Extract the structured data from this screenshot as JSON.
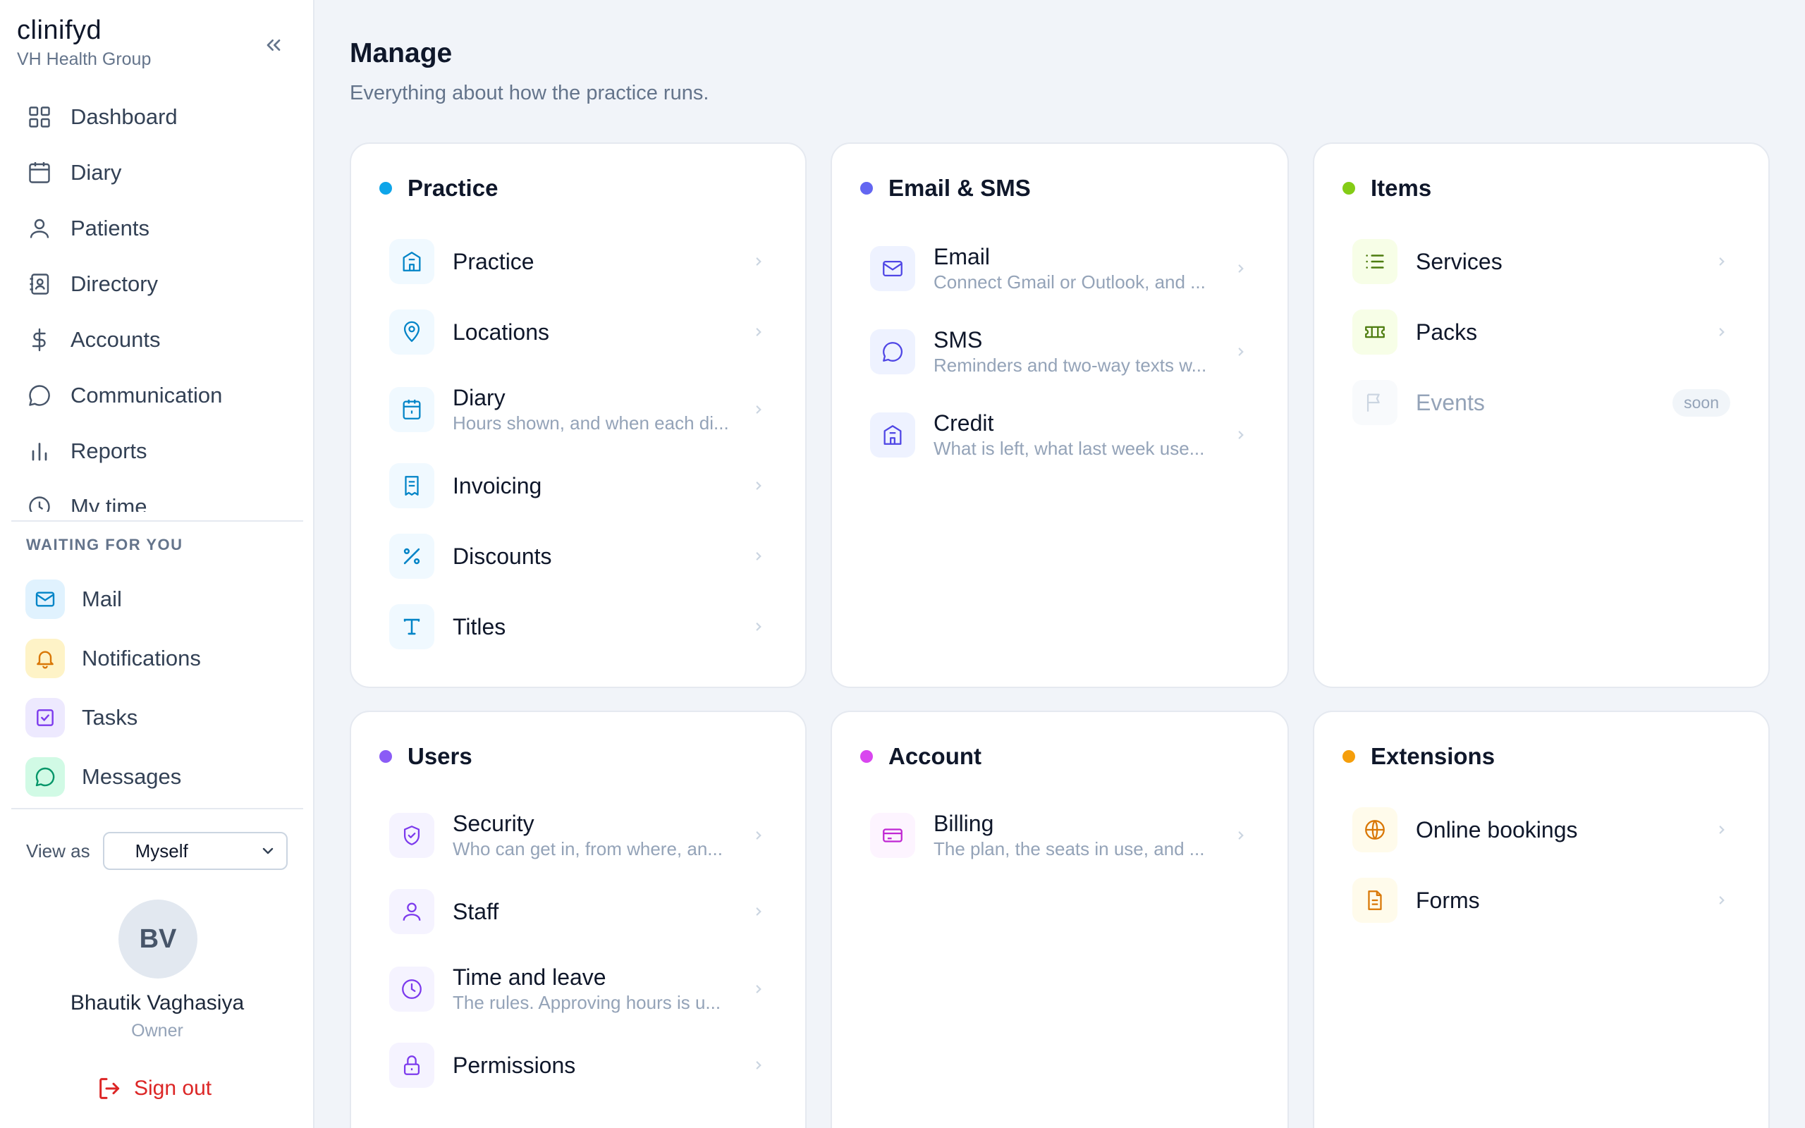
{
  "brand": {
    "name": "clinifyd",
    "org": "VH Health Group"
  },
  "nav": [
    {
      "label": "Dashboard",
      "icon": "grid-icon"
    },
    {
      "label": "Diary",
      "icon": "calendar-icon"
    },
    {
      "label": "Patients",
      "icon": "user-icon"
    },
    {
      "label": "Directory",
      "icon": "contact-book-icon"
    },
    {
      "label": "Accounts",
      "icon": "dollar-icon"
    },
    {
      "label": "Communication",
      "icon": "chat-bubble-icon"
    },
    {
      "label": "Reports",
      "icon": "bar-chart-icon"
    },
    {
      "label": "My time",
      "icon": "clock-icon"
    }
  ],
  "waiting": {
    "label": "WAITING FOR YOU",
    "items": [
      {
        "label": "Mail",
        "icon": "mail-icon",
        "color": "#0284c7",
        "bg": "#e0f2fe"
      },
      {
        "label": "Notifications",
        "icon": "bell-icon",
        "color": "#d97706",
        "bg": "#fef3c7"
      },
      {
        "label": "Tasks",
        "icon": "checkbox-icon",
        "color": "#7c3aed",
        "bg": "#ede9fe"
      },
      {
        "label": "Messages",
        "icon": "chat-icon",
        "color": "#059669",
        "bg": "#d1fae5"
      }
    ]
  },
  "view_as": {
    "label": "View as",
    "value": "Myself"
  },
  "user": {
    "initials": "BV",
    "name": "Bhautik Vaghasiya",
    "role": "Owner"
  },
  "sign_out": "Sign out",
  "page": {
    "title": "Manage",
    "subtitle": "Everything about how the practice runs."
  },
  "cards": {
    "practice": {
      "title": "Practice",
      "color": "#0ea5e9",
      "rows": [
        {
          "title": "Practice",
          "desc": "",
          "icon": "building-icon"
        },
        {
          "title": "Locations",
          "desc": "",
          "icon": "map-pin-icon"
        },
        {
          "title": "Diary",
          "desc": "Hours shown, and when each di...",
          "icon": "calendar-icon"
        },
        {
          "title": "Invoicing",
          "desc": "",
          "icon": "receipt-icon"
        },
        {
          "title": "Discounts",
          "desc": "",
          "icon": "percent-icon"
        },
        {
          "title": "Titles",
          "desc": "",
          "icon": "text-icon"
        }
      ]
    },
    "email_sms": {
      "title": "Email & SMS",
      "color": "#6366f1",
      "rows": [
        {
          "title": "Email",
          "desc": "Connect Gmail or Outlook, and ...",
          "icon": "mail-icon"
        },
        {
          "title": "SMS",
          "desc": "Reminders and two-way texts w...",
          "icon": "chat-bubble-icon"
        },
        {
          "title": "Credit",
          "desc": "What is left, what last week use...",
          "icon": "building-icon"
        }
      ]
    },
    "items": {
      "title": "Items",
      "color": "#84cc16",
      "rows": [
        {
          "title": "Services",
          "desc": "",
          "icon": "list-icon"
        },
        {
          "title": "Packs",
          "desc": "",
          "icon": "ticket-icon"
        },
        {
          "title": "Events",
          "desc": "",
          "icon": "flag-icon",
          "badge": "soon"
        }
      ]
    },
    "users": {
      "title": "Users",
      "color": "#8b5cf6",
      "rows": [
        {
          "title": "Security",
          "desc": "Who can get in, from where, an...",
          "icon": "shield-icon"
        },
        {
          "title": "Staff",
          "desc": "",
          "icon": "user-icon"
        },
        {
          "title": "Time and leave",
          "desc": "The rules. Approving hours is u...",
          "icon": "clock-icon"
        },
        {
          "title": "Permissions",
          "desc": "",
          "icon": "lock-icon"
        }
      ]
    },
    "account": {
      "title": "Account",
      "color": "#d946ef",
      "rows": [
        {
          "title": "Billing",
          "desc": "The plan, the seats in use, and ...",
          "icon": "credit-card-icon"
        }
      ]
    },
    "extensions": {
      "title": "Extensions",
      "color": "#f59e0b",
      "rows": [
        {
          "title": "Online bookings",
          "desc": "",
          "icon": "globe-icon"
        },
        {
          "title": "Forms",
          "desc": "",
          "icon": "document-icon"
        }
      ]
    }
  }
}
